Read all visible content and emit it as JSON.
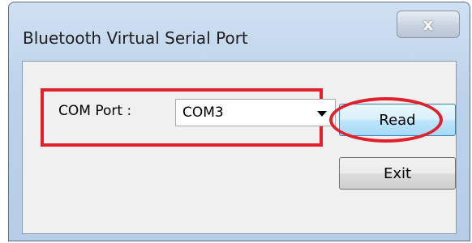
{
  "window": {
    "title": "Bluetooth Virtual Serial Port",
    "close_glyph": "x"
  },
  "form": {
    "com_port_label": "COM Port :",
    "com_port_value": "COM3"
  },
  "buttons": {
    "read_label": "Read",
    "exit_label": "Exit"
  },
  "colors": {
    "highlight": "#e0202a",
    "titlebar": "#bcd2ea",
    "client_bg": "#f0f0f0"
  }
}
